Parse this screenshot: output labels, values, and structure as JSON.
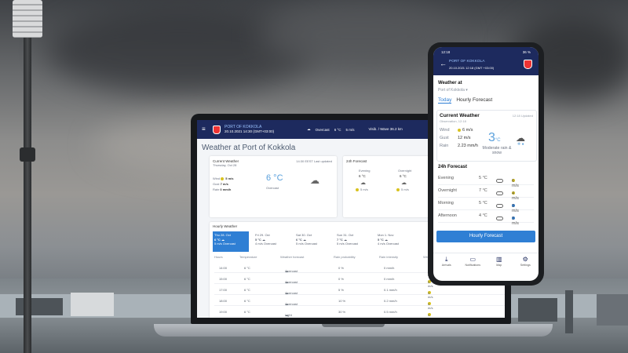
{
  "laptop": {
    "header": {
      "menu_icon": "menu-icon",
      "port_name": "PORT OF KOKKOLA",
      "port_time": "20.10.2021 14:30 (GMT+03:00)",
      "now_condition": "Overcast",
      "now_temp": "6 °C",
      "now_wind": "5 m/s",
      "visibility_label": "Visib. / Wave",
      "visibility_value": "36.2 km"
    },
    "title": "Weather at Port of Kokkola",
    "current": {
      "heading": "Current Weather",
      "subheading": "Thursday, Oct 28",
      "updated": "14:30 EEST Last updated",
      "wind_label": "Wind",
      "wind_value": "5 m/s",
      "gust_label": "Gust",
      "gust_value": "7 m/s",
      "rain_label": "Rain",
      "rain_value": "0 mm/h",
      "temp": "6 °C",
      "condition": "Overcast"
    },
    "forecast24": {
      "heading": "24h Forecast",
      "col1_label": "Evening",
      "col1_temp": "6 °C",
      "col1_wind": "5 m/s",
      "col2_label": "Overnight",
      "col2_temp": "6 °C",
      "col2_wind": "5 m/s"
    },
    "hourly": {
      "heading": "Hourly Weather",
      "cells": [
        {
          "day": "Thu 28. Oct",
          "temp": "6 °C",
          "wind": "5 m/s",
          "cond": "Overcast"
        },
        {
          "day": "Fri 29. Oct",
          "temp": "5 °C",
          "wind": "4 m/s",
          "cond": "Overcast"
        },
        {
          "day": "Sat 30. Oct",
          "temp": "6 °C",
          "wind": "5 m/s",
          "cond": "Overcast"
        },
        {
          "day": "Sun 31. Oct",
          "temp": "7 °C",
          "wind": "5 m/s",
          "cond": "Overcast"
        },
        {
          "day": "Mon 1. Nov",
          "temp": "5 °C",
          "wind": "4 m/s",
          "cond": "Overcast"
        }
      ],
      "columns": [
        "Hours",
        "Temperature",
        "Weather forecast",
        "Rain probability",
        "Rain intensity",
        "Wind"
      ],
      "rows": [
        {
          "time": "14:00",
          "temp": "6 °C",
          "cond": "Overcast",
          "prob": "0 %",
          "intensity": "0 mm/h",
          "wind": "5 m/s"
        },
        {
          "time": "15:00",
          "temp": "6 °C",
          "cond": "Overcast",
          "prob": "0 %",
          "intensity": "0 mm/h",
          "wind": "5 m/s"
        },
        {
          "time": "17:00",
          "temp": "6 °C",
          "cond": "Overcast",
          "prob": "5 %",
          "intensity": "0.1 mm/h",
          "wind": "4 m/s"
        },
        {
          "time": "18:00",
          "temp": "6 °C",
          "cond": "Overcast",
          "prob": "10 %",
          "intensity": "0.2 mm/h",
          "wind": "4 m/s"
        },
        {
          "time": "19:00",
          "temp": "6 °C",
          "cond": "Light rain",
          "prob": "30 %",
          "intensity": "0.5 mm/h",
          "wind": "4 m/s"
        }
      ]
    }
  },
  "phone": {
    "status_time": "12:18",
    "status_right": "36 %",
    "port_name": "PORT OF KOKKOLA",
    "port_time": "20.10.2021 12:18 (GMT +03:00)",
    "weather_at": "Weather at",
    "port_select": "Port of Kokkola",
    "tabs": [
      "Today",
      "Hourly Forecast"
    ],
    "current": {
      "heading": "Current Weather",
      "sub": "Observation, 12:18",
      "ts": "12:18 Updated",
      "wind_label": "Wind",
      "wind_value": "6 m/s",
      "gust_label": "Gust",
      "gust_value": "12 m/s",
      "rain_label": "Rain",
      "rain_value": "2.23 mm/h",
      "temp": "3",
      "temp_unit": "°C",
      "condition": "Moderate rain & snow"
    },
    "forecast_heading": "24h Forecast",
    "forecast": [
      {
        "label": "Evening",
        "temp": "5 °C",
        "wind": "6 m/s"
      },
      {
        "label": "Overnight",
        "temp": "7 °C",
        "wind": "4 m/s"
      },
      {
        "label": "Morning",
        "temp": "5 °C",
        "wind": "3 m/s"
      },
      {
        "label": "Afternoon",
        "temp": "4 °C",
        "wind": "3 m/s"
      }
    ],
    "button_label": "Hourly Forecast",
    "nav": [
      "Arrivals",
      "Notifications",
      "Map",
      "Settings"
    ]
  }
}
